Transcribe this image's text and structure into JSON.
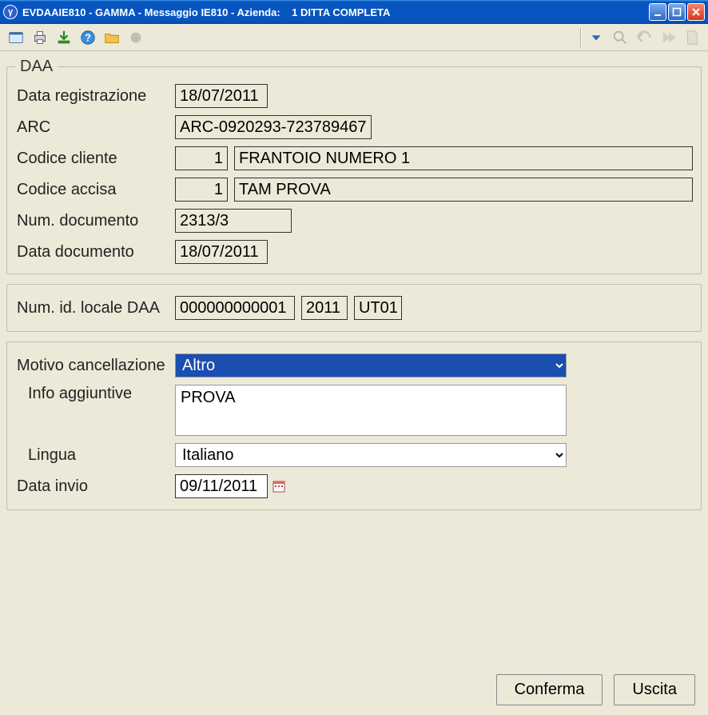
{
  "window": {
    "title": "EVDAAIE810 - GAMMA - Messaggio IE810 - Azienda:    1 DITTA COMPLETA",
    "app_glyph": "γ"
  },
  "daa": {
    "legend": "DAA",
    "labels": {
      "data_registrazione": "Data registrazione",
      "arc": "ARC",
      "codice_cliente": "Codice cliente",
      "codice_accisa": "Codice accisa",
      "num_documento": "Num. documento",
      "data_documento": "Data documento"
    },
    "data_registrazione": "18/07/2011",
    "arc": "ARC-0920293-723789467",
    "codice_cliente_code": "1",
    "codice_cliente_desc": "FRANTOIO NUMERO 1",
    "codice_accisa_code": "1",
    "codice_accisa_desc": "TAM PROVA",
    "num_documento": "2313/3",
    "data_documento": "18/07/2011"
  },
  "locale_daa": {
    "label": "Num. id. locale DAA",
    "id": "000000000001",
    "year": "2011",
    "ut": "UT01"
  },
  "cancellazione": {
    "labels": {
      "motivo": "Motivo cancellazione",
      "info": "Info aggiuntive",
      "lingua": "Lingua",
      "data_invio": "Data invio"
    },
    "motivo_selected": "Altro",
    "info": "PROVA",
    "lingua_selected": "Italiano",
    "data_invio": "09/11/2011"
  },
  "footer": {
    "conferma": "Conferma",
    "uscita": "Uscita"
  }
}
